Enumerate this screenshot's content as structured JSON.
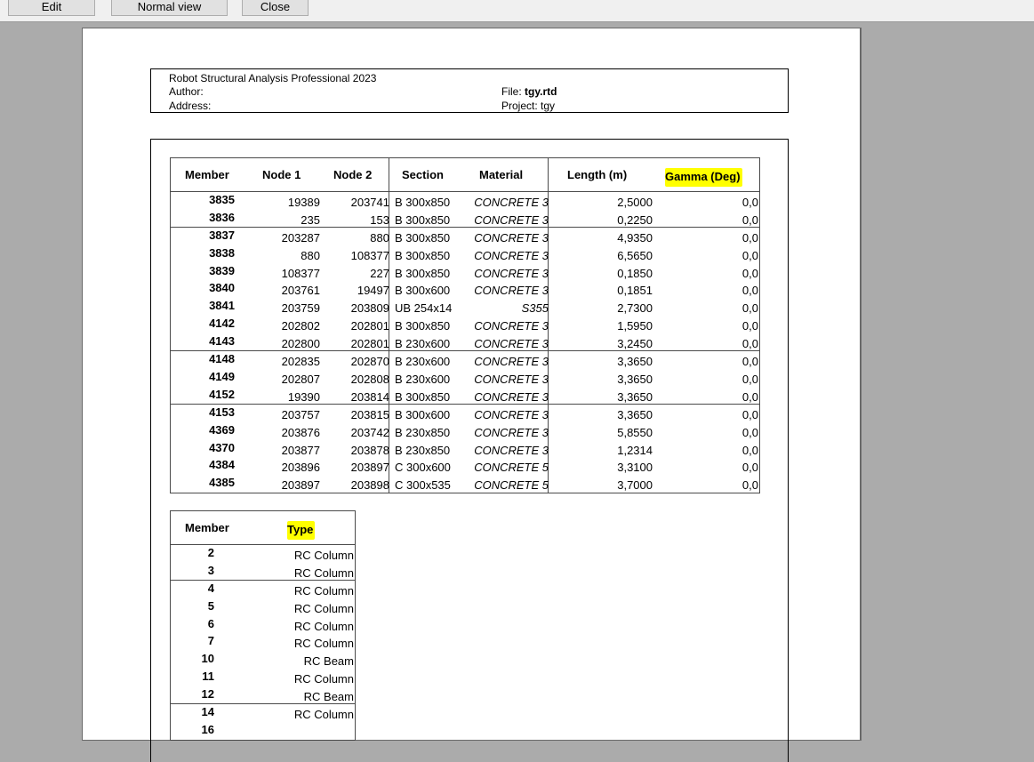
{
  "toolbar": {
    "edit_label": "Edit",
    "normal_view_label": "Normal view",
    "close_label": "Close"
  },
  "header": {
    "app_title": "Robot Structural Analysis Professional 2023",
    "author_label": "Author:",
    "address_label": "Address:",
    "file_label": "File:",
    "file_value": "tgy.rtd",
    "project_label": "Project:",
    "project_value": "tgy"
  },
  "highlight_color": "#ffff00",
  "members_table": {
    "columns": [
      "Member",
      "Node 1",
      "Node 2",
      "Section",
      "Material",
      "Length (m)",
      "Gamma (Deg)"
    ],
    "highlighted_column": "Gamma (Deg)",
    "groups": [
      [
        [
          "3835",
          "19389",
          "203741",
          "B 300x850",
          "CONCRETE 3",
          "2,5000",
          "0,0"
        ],
        [
          "3836",
          "235",
          "153",
          "B 300x850",
          "CONCRETE 3",
          "0,2250",
          "0,0"
        ]
      ],
      [
        [
          "3837",
          "203287",
          "880",
          "B 300x850",
          "CONCRETE 3",
          "4,9350",
          "0,0"
        ],
        [
          "3838",
          "880",
          "108377",
          "B 300x850",
          "CONCRETE 3",
          "6,5650",
          "0,0"
        ],
        [
          "3839",
          "108377",
          "227",
          "B 300x850",
          "CONCRETE 3",
          "0,1850",
          "0,0"
        ],
        [
          "3840",
          "203761",
          "19497",
          "B 300x600",
          "CONCRETE 3",
          "0,1851",
          "0,0"
        ],
        [
          "3841",
          "203759",
          "203809",
          "UB 254x14",
          "S355",
          "2,7300",
          "0,0"
        ],
        [
          "4142",
          "202802",
          "202801",
          "B 300x850",
          "CONCRETE 3",
          "1,5950",
          "0,0"
        ],
        [
          "4143",
          "202800",
          "202801",
          "B 230x600",
          "CONCRETE 3",
          "3,2450",
          "0,0"
        ]
      ],
      [
        [
          "4148",
          "202835",
          "202870",
          "B 230x600",
          "CONCRETE 3",
          "3,3650",
          "0,0"
        ],
        [
          "4149",
          "202807",
          "202808",
          "B 230x600",
          "CONCRETE 3",
          "3,3650",
          "0,0"
        ],
        [
          "4152",
          "19390",
          "203814",
          "B 300x850",
          "CONCRETE 3",
          "3,3650",
          "0,0"
        ]
      ],
      [
        [
          "4153",
          "203757",
          "203815",
          "B 300x600",
          "CONCRETE 3",
          "3,3650",
          "0,0"
        ],
        [
          "4369",
          "203876",
          "203742",
          "B 230x850",
          "CONCRETE 3",
          "5,8550",
          "0,0"
        ],
        [
          "4370",
          "203877",
          "203878",
          "B 230x850",
          "CONCRETE 3",
          "1,2314",
          "0,0"
        ],
        [
          "4384",
          "203896",
          "203897",
          "C 300x600",
          "CONCRETE 5",
          "3,3100",
          "0,0"
        ],
        [
          "4385",
          "203897",
          "203898",
          "C 300x535",
          "CONCRETE 5",
          "3,7000",
          "0,0"
        ]
      ]
    ]
  },
  "types_table": {
    "columns": [
      "Member",
      "Type"
    ],
    "highlighted_column": "Type",
    "groups": [
      [
        [
          "2",
          "RC Column"
        ],
        [
          "3",
          "RC Column"
        ]
      ],
      [
        [
          "4",
          "RC Column"
        ],
        [
          "5",
          "RC Column"
        ],
        [
          "6",
          "RC Column"
        ],
        [
          "7",
          "RC Column"
        ],
        [
          "10",
          "RC Beam"
        ],
        [
          "11",
          "RC Column"
        ],
        [
          "12",
          "RC Beam"
        ]
      ],
      [
        [
          "14",
          "RC Column"
        ],
        [
          "16",
          ""
        ]
      ]
    ]
  }
}
